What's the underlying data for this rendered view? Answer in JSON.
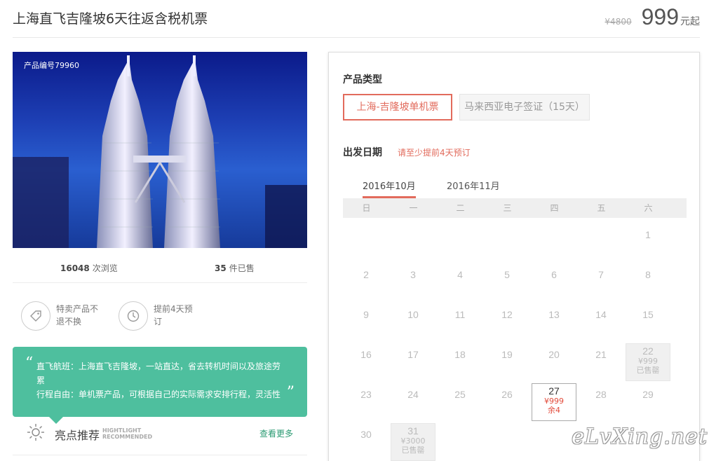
{
  "header": {
    "title": "上海直飞吉隆坡6天往返含税机票",
    "original_price": "¥4800",
    "price": "999",
    "price_suffix": "元起"
  },
  "photo": {
    "product_code": "产品编号79960"
  },
  "stats": {
    "views_count": "16048",
    "views_label": "次浏览",
    "sold_count": "35",
    "sold_label": "件已售"
  },
  "features": [
    {
      "icon": "tag-icon",
      "text": "特卖产品不退不换"
    },
    {
      "icon": "clock-icon",
      "text": "提前4天预订"
    }
  ],
  "highlights": {
    "line1": "直飞航班：上海直飞吉隆坡，一站直达，省去转机时间以及旅途劳累",
    "line2": "行程自由：单机票产品，可根据自己的实际需求安排行程，灵活性",
    "title": "亮点推荐",
    "en_line1": "HIGHTLIGHT",
    "en_line2": "RECOMMENDED",
    "more": "查看更多"
  },
  "booking": {
    "type_label": "产品类型",
    "types": [
      "上海-吉隆坡单机票",
      "马来西亚电子签证（15天）"
    ],
    "selected_type": "上海-吉隆坡单机票",
    "date_label": "出发日期",
    "date_note": "请至少提前4天预订",
    "months": [
      "2016年10月",
      "2016年11月"
    ],
    "active_month": "2016年10月",
    "weekdays": [
      "日",
      "一",
      "二",
      "三",
      "四",
      "五",
      "六"
    ],
    "special_days": {
      "22": {
        "price": "¥999",
        "status": "已售罄"
      },
      "27": {
        "price": "¥999",
        "status": "余4"
      },
      "31": {
        "price": "¥3000",
        "status": "已售罄"
      }
    }
  },
  "watermark": "eLvXing.net",
  "colors": {
    "accent": "#e26b5c",
    "green": "#4ebf9e",
    "link": "#2a9a72"
  }
}
